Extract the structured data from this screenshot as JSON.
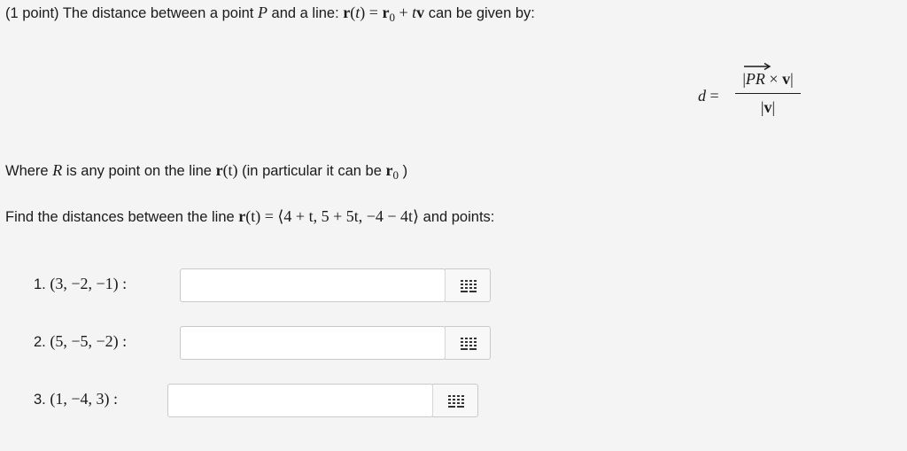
{
  "intro": {
    "prefix": "(1 point) The distance between a point ",
    "point_var": "P",
    "mid": " and a line: ",
    "r": "r",
    "t_open": "(",
    "t": "t",
    "t_close": ")",
    "eq": " = ",
    "r0": "r",
    "r0_sub": "0",
    "plus": " + ",
    "tv_t": "t",
    "tv_v": "v",
    "suffix": " can be given by:"
  },
  "formula": {
    "lhs": "d",
    "eq": "=",
    "num_left": "|",
    "num_vec": "PR",
    "num_times": " × ",
    "num_v": "v",
    "num_right": "|",
    "den_left": "|",
    "den_v": "v",
    "den_right": "|"
  },
  "where_line": {
    "prefix": "Where ",
    "R": "R",
    "mid": " is any point on the line ",
    "r": "r",
    "t_expr": "(t)",
    "paren": " (in particular it can be ",
    "r0": "r",
    "r0_sub": "0",
    "close": " )"
  },
  "find_line": {
    "prefix": "Find the distances between the line ",
    "r": "r",
    "expr": "(t) = ⟨4 + t, 5 + 5t, −4 − 4t⟩",
    "suffix": " and points:"
  },
  "points": [
    {
      "number": "1. ",
      "coords": "(3, −2, −1) :",
      "value": "",
      "placeholder": ""
    },
    {
      "number": "2. ",
      "coords": "(5, −5, −2) :",
      "value": "",
      "placeholder": ""
    },
    {
      "number": "3. ",
      "coords": "(1, −4, 3) :",
      "value": "",
      "placeholder": ""
    }
  ],
  "icons": {
    "keypad": "keypad-grid-icon"
  }
}
